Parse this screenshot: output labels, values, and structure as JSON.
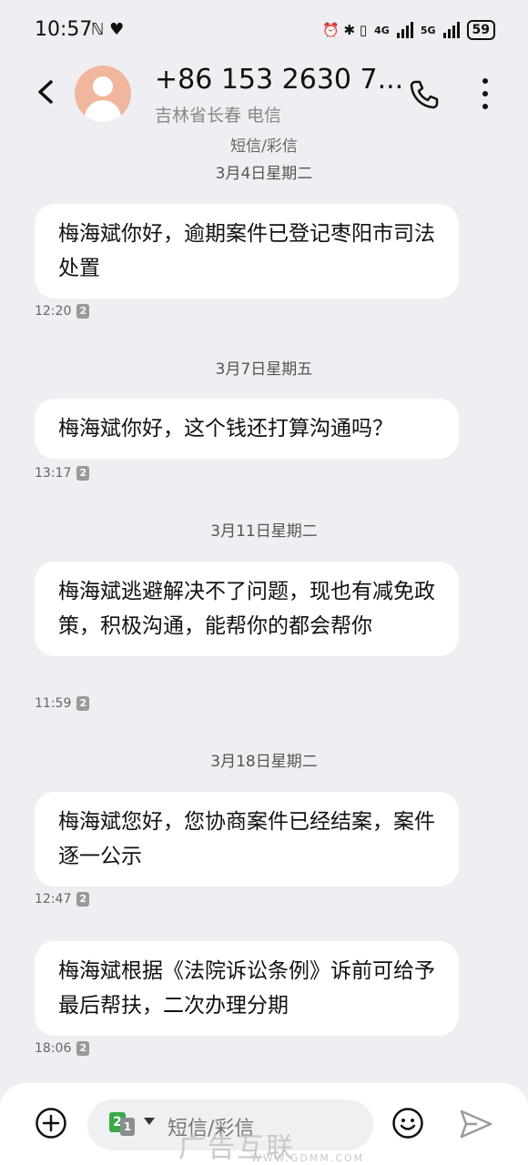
{
  "status_bar": {
    "time": "10:57",
    "left_icons": "ℕ ♥",
    "right_icons": "⏰ ✱ ▯",
    "net1": "4G",
    "net2": "5G",
    "battery": "59"
  },
  "header": {
    "contact_name": "+86 153 2630 7...",
    "contact_sub": "吉林省长春 电信",
    "channel": "短信/彩信"
  },
  "messages": [
    {
      "date": "3月4日星期二",
      "text": "梅海斌你好，逾期案件已登记枣阳市司法处置",
      "time": "12:20",
      "sim": "2"
    },
    {
      "date": "3月7日星期五",
      "text": "梅海斌你好，这个钱还打算沟通吗？",
      "time": "13:17",
      "sim": "2"
    },
    {
      "date": "3月11日星期二",
      "text": "梅海斌逃避解决不了问题，现也有减免政策，积极沟通，能帮你的都会帮你",
      "time": "11:59",
      "sim": "2"
    },
    {
      "date": "3月18日星期二",
      "text": "梅海斌您好，您协商案件已经结案，案件逐一公示",
      "time": "12:47",
      "sim": "2"
    },
    {
      "date": "",
      "text": "梅海斌根据《法院诉讼条例》诉前可给予最后帮扶，二次办理分期",
      "time": "18:06",
      "sim": "2"
    }
  ],
  "compose": {
    "placeholder": "短信/彩信",
    "sim_primary": "2",
    "sim_secondary": "1"
  },
  "watermark": {
    "main": "广告互联",
    "sub": "WWW.GDMM.COM"
  },
  "icons": {
    "back": "chevron-left-icon",
    "call": "phone-icon",
    "more": "more-vertical-icon",
    "add": "plus-circle-icon",
    "emoji": "smiley-icon",
    "send": "send-icon"
  }
}
